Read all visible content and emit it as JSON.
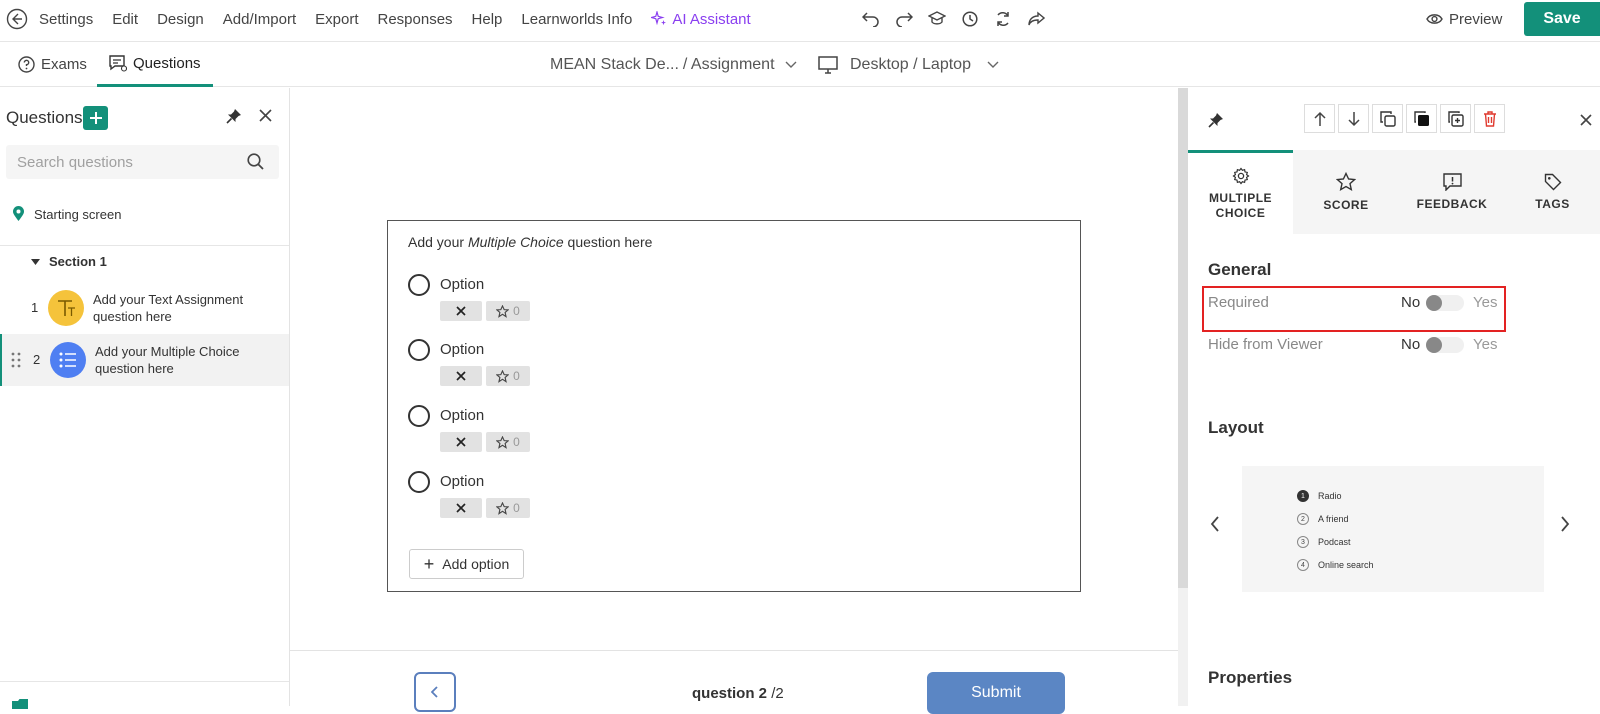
{
  "menu": {
    "items": [
      "Settings",
      "Edit",
      "Design",
      "Add/Import",
      "Export",
      "Responses",
      "Help",
      "Learnworlds Info"
    ],
    "ai_label": "AI Assistant",
    "preview_label": "Preview",
    "save_label": "Save"
  },
  "tabs": {
    "exams": "Exams",
    "questions": "Questions"
  },
  "breadcrumb": {
    "course": "MEAN Stack De...",
    "page": "/ Assignment"
  },
  "device": {
    "label": "Desktop / Laptop"
  },
  "sidebar": {
    "title": "Questions",
    "search_placeholder": "Search questions",
    "starting_screen": "Starting screen",
    "section": "Section 1",
    "questions": [
      {
        "num": "1",
        "text": "Add your Text Assignment question here",
        "color": "#f5c33b"
      },
      {
        "num": "2",
        "text": "Add your Multiple Choice question here",
        "color": "#4f7ff2"
      }
    ]
  },
  "question": {
    "prefix": "Add your ",
    "type": "Multiple Choice",
    "suffix": " question here",
    "options": [
      {
        "label": "Option",
        "score": "0"
      },
      {
        "label": "Option",
        "score": "0"
      },
      {
        "label": "Option",
        "score": "0"
      },
      {
        "label": "Option",
        "score": "0"
      }
    ],
    "add_option": "Add option"
  },
  "footer": {
    "current": "question 2",
    "total": "/2",
    "submit": "Submit"
  },
  "panel": {
    "tabs": [
      {
        "label": "MULTIPLE\nCHOICE",
        "icon": "gear-icon"
      },
      {
        "label": "SCORE",
        "icon": "star-icon"
      },
      {
        "label": "FEEDBACK",
        "icon": "feedback-icon"
      },
      {
        "label": "TAGS",
        "icon": "tag-icon"
      }
    ],
    "general_title": "General",
    "required": {
      "label": "Required",
      "no": "No",
      "yes": "Yes",
      "value": false
    },
    "hide_viewer": {
      "label": "Hide from Viewer",
      "no": "No",
      "yes": "Yes",
      "value": false
    },
    "layout_title": "Layout",
    "layout_preview": [
      {
        "n": "1",
        "text": "Radio"
      },
      {
        "n": "2",
        "text": "A friend"
      },
      {
        "n": "3",
        "text": "Podcast"
      },
      {
        "n": "4",
        "text": "Online search"
      }
    ],
    "properties_title": "Properties"
  },
  "colors": {
    "accent": "#13907a",
    "ai": "#8a3ff0",
    "highlight": "#e32222",
    "submit": "#5b86c4"
  }
}
